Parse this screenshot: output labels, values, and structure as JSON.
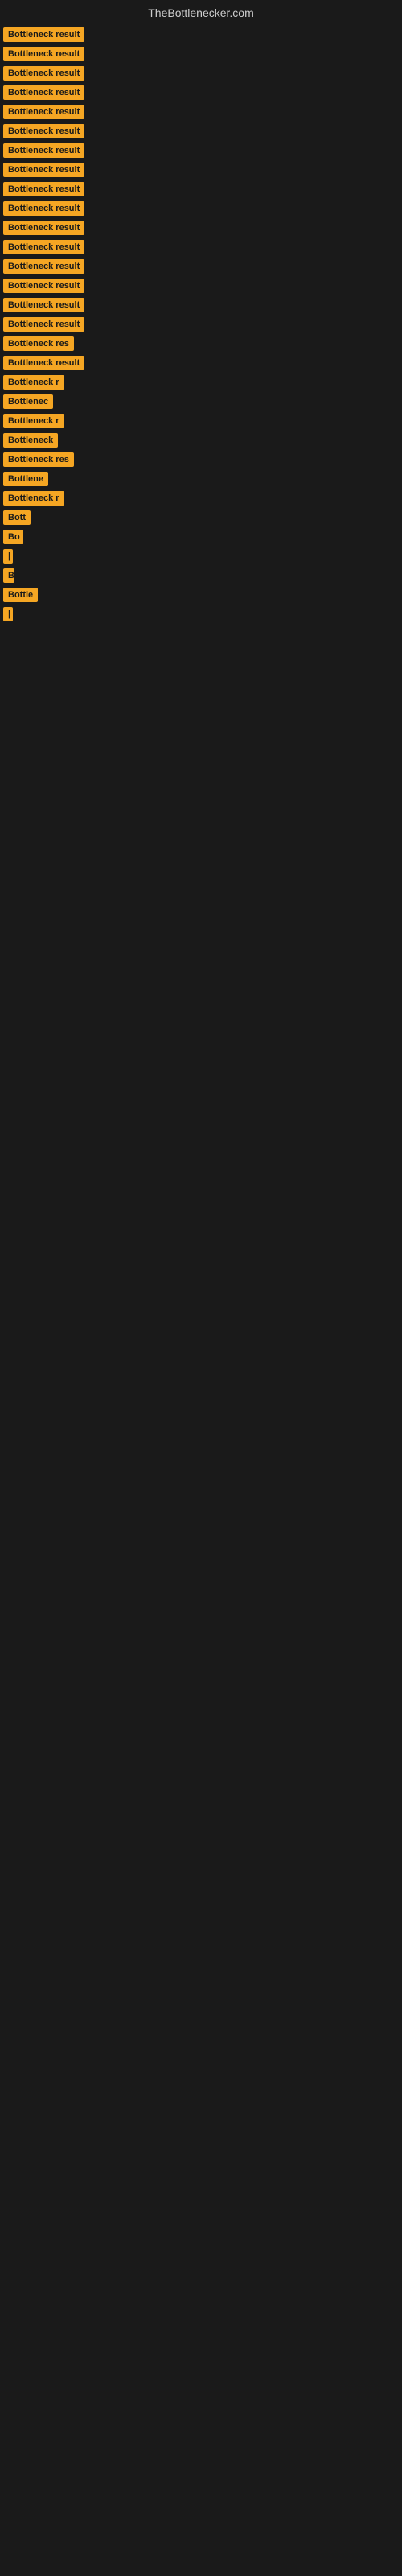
{
  "header": {
    "title": "TheBottlenecker.com"
  },
  "items": [
    {
      "label": "Bottleneck result",
      "width": 120
    },
    {
      "label": "Bottleneck result",
      "width": 120
    },
    {
      "label": "Bottleneck result",
      "width": 120
    },
    {
      "label": "Bottleneck result",
      "width": 120
    },
    {
      "label": "Bottleneck result",
      "width": 120
    },
    {
      "label": "Bottleneck result",
      "width": 120
    },
    {
      "label": "Bottleneck result",
      "width": 120
    },
    {
      "label": "Bottleneck result",
      "width": 120
    },
    {
      "label": "Bottleneck result",
      "width": 120
    },
    {
      "label": "Bottleneck result",
      "width": 120
    },
    {
      "label": "Bottleneck result",
      "width": 120
    },
    {
      "label": "Bottleneck result",
      "width": 120
    },
    {
      "label": "Bottleneck result",
      "width": 110
    },
    {
      "label": "Bottleneck result",
      "width": 110
    },
    {
      "label": "Bottleneck result",
      "width": 110
    },
    {
      "label": "Bottleneck result",
      "width": 110
    },
    {
      "label": "Bottleneck res",
      "width": 100
    },
    {
      "label": "Bottleneck result",
      "width": 110
    },
    {
      "label": "Bottleneck r",
      "width": 90
    },
    {
      "label": "Bottlenec",
      "width": 80
    },
    {
      "label": "Bottleneck r",
      "width": 90
    },
    {
      "label": "Bottleneck",
      "width": 80
    },
    {
      "label": "Bottleneck res",
      "width": 100
    },
    {
      "label": "Bottlene",
      "width": 72
    },
    {
      "label": "Bottleneck r",
      "width": 90
    },
    {
      "label": "Bott",
      "width": 40
    },
    {
      "label": "Bo",
      "width": 25
    },
    {
      "label": "|",
      "width": 8
    },
    {
      "label": "B",
      "width": 14
    },
    {
      "label": "Bottle",
      "width": 50
    },
    {
      "label": "|",
      "width": 8
    }
  ],
  "colors": {
    "badge_bg": "#f5a623",
    "body_bg": "#1a1a1a",
    "title_color": "#cccccc"
  }
}
